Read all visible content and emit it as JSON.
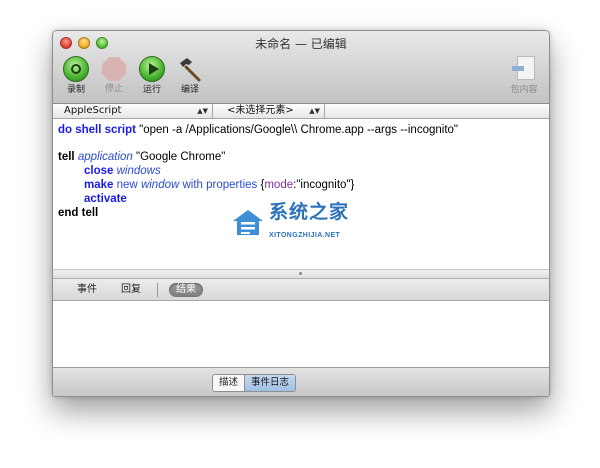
{
  "window": {
    "title": "未命名 — 已编辑"
  },
  "toolbar": {
    "record_label": "录制",
    "stop_label": "停止",
    "run_label": "运行",
    "compile_label": "编译",
    "bundle_contents_label": "包内容"
  },
  "selector_bar": {
    "language": "AppleScript",
    "element": "<未选择元素>"
  },
  "script": {
    "line1_kw": "do shell script",
    "line1_str": " \"open -a /Applications/Google\\\\ Chrome.app --args --incognito\"",
    "line2_kw": "tell",
    "line2_cls": "application",
    "line2_str": " \"Google Chrome\"",
    "line3_kw": "close",
    "line3_cls": "windows",
    "line4_kw": "make",
    "line4_new": "new",
    "line4_cls": "window",
    "line4_with": "with properties",
    "line4_open": " {",
    "line4_prop": "mode",
    "line4_val": ":\"incognito\"}",
    "line5_kw": "activate",
    "line6_kw": "end tell"
  },
  "watermark": {
    "cn": "系统之家",
    "en": "XITONGZHIJIA.NET"
  },
  "result_tabs": {
    "events": "事件",
    "replies": "回复",
    "result": "结果"
  },
  "bottom": {
    "description": "描述",
    "event_log": "事件日志"
  },
  "colors": {
    "keyword": "#1a1ae6",
    "class": "#2b4bd6",
    "property": "#7d2fa0",
    "watermark": "#2c72b8"
  }
}
